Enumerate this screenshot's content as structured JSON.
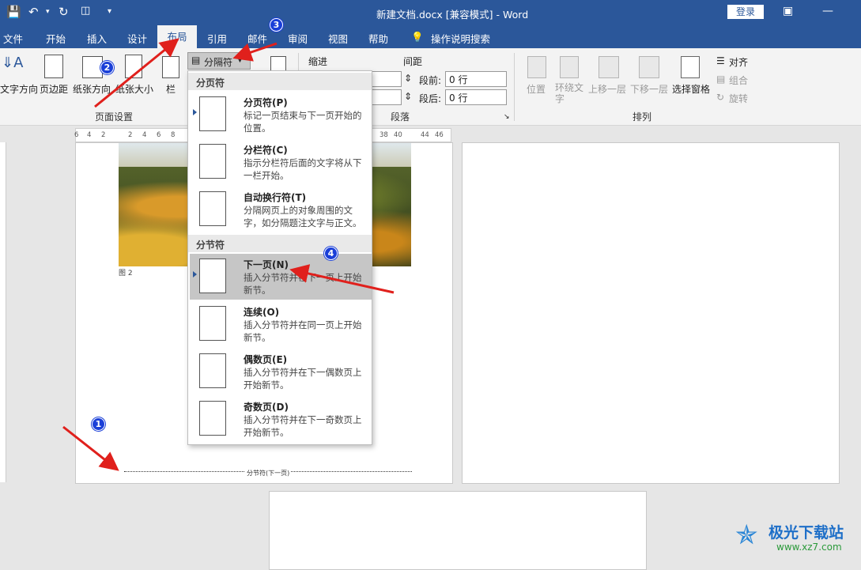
{
  "titlebar": {
    "doc_title": "新建文档.docx [兼容模式]  -  Word",
    "login": "登录"
  },
  "tabs": [
    "文件",
    "开始",
    "插入",
    "设计",
    "布局",
    "引用",
    "邮件",
    "审阅",
    "视图",
    "帮助"
  ],
  "tell_me": "操作说明搜索",
  "ribbon": {
    "page_setup": {
      "text_direction": "文字方向",
      "margins": "页边距",
      "orientation": "纸张方向",
      "size": "纸张大小",
      "columns": "栏",
      "group_label": "页面设置"
    },
    "breaks_button": "分隔符",
    "indent_label": "缩进",
    "spacing_label": "间距",
    "before_label": "段前:",
    "before_value": "0 行",
    "after_label": "段后:",
    "after_value": "0 行",
    "paragraph_group": "段落",
    "arrange": {
      "position": "位置",
      "wrap_text": "环绕文字",
      "bring_forward": "上移一层",
      "send_backward": "下移一层",
      "selection_pane": "选择窗格",
      "align": "对齐",
      "group": "组合",
      "rotate": "旋转",
      "group_label": "排列"
    }
  },
  "ruler_ticks": [
    "6",
    "4",
    "2",
    "2",
    "4",
    "6",
    "8",
    "38",
    "40",
    "44",
    "46"
  ],
  "dropdown": {
    "page_breaks_header": "分页符",
    "section_breaks_header": "分节符",
    "items": [
      {
        "title": "分页符(P)",
        "desc": "标记一页结束与下一页开始的位置。"
      },
      {
        "title": "分栏符(C)",
        "desc": "指示分栏符后面的文字将从下一栏开始。"
      },
      {
        "title": "自动换行符(T)",
        "desc": "分隔网页上的对象周围的文字，如分隔题注文字与正文。"
      },
      {
        "title": "下一页(N)",
        "desc": "插入分节符并在下一页上开始新节。"
      },
      {
        "title": "连续(O)",
        "desc": "插入分节符并在同一页上开始新节。"
      },
      {
        "title": "偶数页(E)",
        "desc": "插入分节符并在下一偶数页上开始新节。"
      },
      {
        "title": "奇数页(D)",
        "desc": "插入分节符并在下一奇数页上开始新节。"
      }
    ]
  },
  "document": {
    "caption": "图 2",
    "section_break_label": "分节符(下一页)"
  },
  "badges": [
    "1",
    "2",
    "3",
    "4"
  ],
  "watermark": {
    "main": "极光下载站",
    "sub": "www.xz7.com"
  },
  "colors": {
    "accent": "#2b579a",
    "arrow": "#e0201c",
    "badge": "#1a3fd8"
  }
}
